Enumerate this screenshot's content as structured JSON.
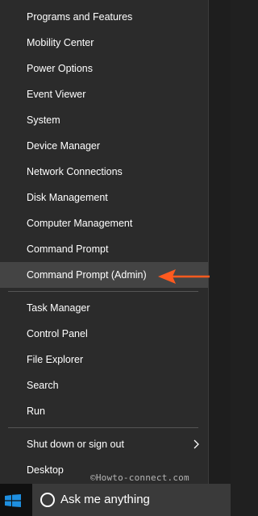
{
  "menu": {
    "items": [
      "Programs and Features",
      "Mobility Center",
      "Power Options",
      "Event Viewer",
      "System",
      "Device Manager",
      "Network Connections",
      "Disk Management",
      "Computer Management",
      "Command Prompt",
      "Command Prompt (Admin)",
      "Task Manager",
      "Control Panel",
      "File Explorer",
      "Search",
      "Run",
      "Shut down or sign out",
      "Desktop"
    ],
    "highlighted_item": "Command Prompt (Admin)"
  },
  "watermark": "©Howto-connect.com",
  "taskbar": {
    "search_placeholder": "Ask me anything",
    "start_icon": "windows-logo-icon",
    "search_icon": "cortana-circle-icon"
  },
  "annotation": {
    "arrow_icon": "arrow-left-icon",
    "arrow_color": "#ff5a1f"
  },
  "colors": {
    "menu_background": "#2b2b2b",
    "highlight": "#444444",
    "windows_logo": "#1e8fe0"
  }
}
